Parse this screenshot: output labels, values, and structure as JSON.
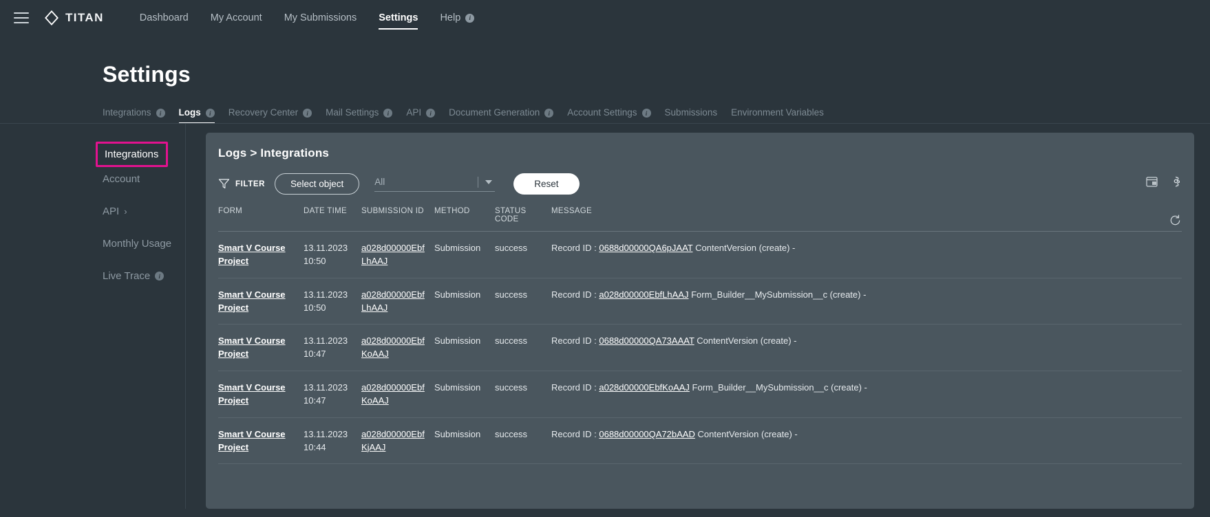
{
  "topnav": {
    "menu_icon": "hamburger-icon",
    "brand": "TITAN",
    "items": [
      {
        "label": "Dashboard",
        "badge": null,
        "active": false
      },
      {
        "label": "My Account",
        "badge": null,
        "active": false
      },
      {
        "label": "My Submissions",
        "badge": null,
        "active": false
      },
      {
        "label": "Settings",
        "badge": null,
        "active": true
      },
      {
        "label": "Help",
        "badge": "i",
        "active": false
      }
    ]
  },
  "page": {
    "title": "Settings",
    "tabs": [
      {
        "label": "Integrations",
        "badge": "i",
        "active": false
      },
      {
        "label": "Logs",
        "badge": "i",
        "active": true
      },
      {
        "label": "Recovery Center",
        "badge": "i",
        "active": false
      },
      {
        "label": "Mail Settings",
        "badge": "i",
        "active": false
      },
      {
        "label": "API",
        "badge": "i",
        "active": false
      },
      {
        "label": "Document Generation",
        "badge": "i",
        "active": false
      },
      {
        "label": "Account Settings",
        "badge": "i",
        "active": false
      },
      {
        "label": "Submissions",
        "badge": null,
        "active": false
      },
      {
        "label": "Environment Variables",
        "badge": null,
        "active": false
      }
    ]
  },
  "sidebar": {
    "items": [
      {
        "label": "Integrations",
        "selected": true,
        "chevron": false,
        "badge": null
      },
      {
        "label": "Account",
        "selected": false,
        "chevron": false,
        "badge": null
      },
      {
        "label": "API",
        "selected": false,
        "chevron": true,
        "badge": null
      },
      {
        "label": "Monthly Usage",
        "selected": false,
        "chevron": false,
        "badge": null
      },
      {
        "label": "Live Trace",
        "selected": false,
        "chevron": false,
        "badge": "i"
      }
    ],
    "highlight_color": "#e3128f"
  },
  "card": {
    "title": "Logs > Integrations",
    "filter": {
      "icon": "funnel-icon",
      "label": "FILTER",
      "select_object_label": "Select object",
      "dropdown_value": "All",
      "reset_label": "Reset"
    },
    "bar_icons": [
      "calendar-export-icon",
      "gear-icon"
    ],
    "refresh_icon": "refresh-icon",
    "columns": [
      "FORM",
      "DATE TIME",
      "SUBMISSION ID",
      "METHOD",
      "STATUS CODE",
      "MESSAGE"
    ],
    "rows": [
      {
        "form": "Smart V Course Project",
        "datetime": "13.11.2023 10:50",
        "submission_id": "a028d00000EbfLhAAJ",
        "method": "Submission",
        "status_code": "success",
        "message_prefix": "Record ID : ",
        "message_id": "0688d00000QA6pJAAT",
        "message_suffix": " ContentVersion (create) -"
      },
      {
        "form": "Smart V Course Project",
        "datetime": "13.11.2023 10:50",
        "submission_id": "a028d00000EbfLhAAJ",
        "method": "Submission",
        "status_code": "success",
        "message_prefix": "Record ID : ",
        "message_id": "a028d00000EbfLhAAJ",
        "message_suffix": " Form_Builder__MySubmission__c (create) -"
      },
      {
        "form": "Smart V Course Project",
        "datetime": "13.11.2023 10:47",
        "submission_id": "a028d00000EbfKoAAJ",
        "method": "Submission",
        "status_code": "success",
        "message_prefix": "Record ID : ",
        "message_id": "0688d00000QA73AAAT",
        "message_suffix": " ContentVersion (create) -"
      },
      {
        "form": "Smart V Course Project",
        "datetime": "13.11.2023 10:47",
        "submission_id": "a028d00000EbfKoAAJ",
        "method": "Submission",
        "status_code": "success",
        "message_prefix": "Record ID : ",
        "message_id": "a028d00000EbfKoAAJ",
        "message_suffix": " Form_Builder__MySubmission__c (create) -"
      },
      {
        "form": "Smart V Course Project",
        "datetime": "13.11.2023 10:44",
        "submission_id": "a028d00000EbfKjAAJ",
        "method": "Submission",
        "status_code": "success",
        "message_prefix": "Record ID : ",
        "message_id": "0688d00000QA72bAAD",
        "message_suffix": " ContentVersion (create) -"
      }
    ]
  }
}
